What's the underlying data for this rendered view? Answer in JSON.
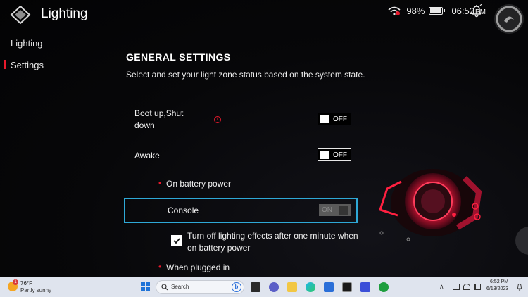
{
  "app": {
    "title": "Lighting",
    "logo_icon": "armoury-crate-logo-icon"
  },
  "status_bar": {
    "wifi_icon": "wifi-alert-icon",
    "battery_percent": "98%",
    "battery_level": 0.98,
    "time": "06:52",
    "ampm": "PM",
    "notification_icon": "bell-icon"
  },
  "sidebar": {
    "items": [
      {
        "label": "Lighting",
        "selected": false
      },
      {
        "label": "Settings",
        "selected": true
      }
    ]
  },
  "main": {
    "section_title": "GENERAL SETTINGS",
    "section_description": "Select and set your light zone status based on the system state.",
    "rows": [
      {
        "label": "Boot up,Shut down",
        "toggle": "OFF",
        "has_info_icon": true
      },
      {
        "label": "Awake",
        "toggle": "OFF",
        "has_info_icon": false
      }
    ],
    "battery_section_label": "On battery power",
    "console_label": "Console",
    "console_toggle": "ON",
    "checkbox_label": "Turn off lighting effects after one minute when on battery power",
    "checkbox_checked": true,
    "plugged_section_label": "When plugged in"
  },
  "taskbar": {
    "weather_temp": "76°F",
    "weather_condition": "Partly sunny",
    "weather_badge": "1",
    "search_placeholder": "Search",
    "clock_time": "6:52 PM",
    "clock_date": "6/13/2023",
    "apps": [
      "start-icon",
      "search-icon",
      "bing-icon",
      "task-view-icon",
      "chat-icon",
      "folder-icon",
      "edge-icon",
      "store-icon",
      "armoury-crate-icon",
      "editor-icon",
      "xbox-icon"
    ]
  },
  "colors": {
    "accent_red": "#e8192c",
    "focus_blue": "#2ea8d6",
    "taskbar_bg": "#dfe4ee"
  }
}
